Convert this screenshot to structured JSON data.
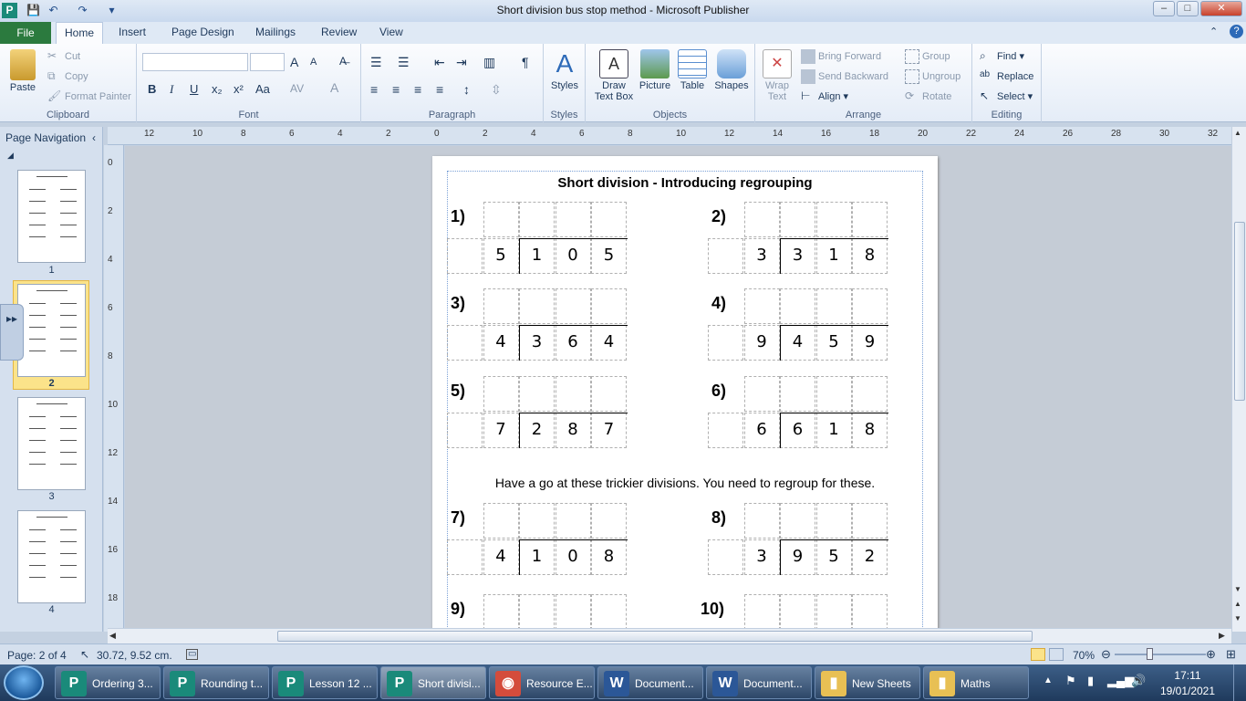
{
  "window": {
    "title": "Short division bus stop method  -  Microsoft Publisher",
    "app_icon": "publisher-icon",
    "quick_access": [
      "save-icon",
      "undo-icon",
      "redo-icon",
      "customize-icon"
    ],
    "controls": {
      "minimize": "–",
      "maximize": "□",
      "close": "✕"
    }
  },
  "tabs": {
    "file": "File",
    "items": [
      "Home",
      "Insert",
      "Page Design",
      "Mailings",
      "Review",
      "View"
    ],
    "selected": "Home"
  },
  "ribbon": {
    "clipboard": {
      "paste": "Paste",
      "cut": "Cut",
      "copy": "Copy",
      "format_painter": "Format Painter",
      "label": "Clipboard"
    },
    "font": {
      "label": "Font",
      "bold": "B",
      "italic": "I",
      "underline": "U",
      "subscript": "x₂",
      "superscript": "x²",
      "case": "Aa",
      "spacing": "AV",
      "color": "A",
      "grow": "A",
      "shrink": "A"
    },
    "paragraph": {
      "label": "Paragraph",
      "pilcrow": "¶"
    },
    "styles": {
      "styles": "Styles",
      "label": "Styles"
    },
    "objects": {
      "draw_text_box": "Draw\nText Box",
      "draw_line1": "Draw",
      "draw_line2": "Text Box",
      "picture": "Picture",
      "table": "Table",
      "shapes": "Shapes",
      "label": "Objects"
    },
    "arrange": {
      "wrap_text1": "Wrap",
      "wrap_text2": "Text",
      "bring_forward": "Bring Forward",
      "send_backward": "Send Backward",
      "align": "Align",
      "group": "Group",
      "ungroup": "Ungroup",
      "rotate": "Rotate",
      "label": "Arrange"
    },
    "editing": {
      "find": "Find",
      "replace": "Replace",
      "select": "Select",
      "label": "Editing"
    }
  },
  "nav": {
    "title": "Page Navigation",
    "pages": [
      "1",
      "2",
      "3",
      "4"
    ],
    "selected_page": "2"
  },
  "rulers": {
    "horizontal": [
      "12",
      "10",
      "8",
      "6",
      "4",
      "2",
      "0",
      "2",
      "4",
      "6",
      "8",
      "10",
      "12",
      "14",
      "16",
      "18",
      "20",
      "22",
      "24",
      "26",
      "28",
      "30",
      "32"
    ],
    "vertical": [
      "0",
      "2",
      "4",
      "6",
      "8",
      "10",
      "12",
      "14",
      "16",
      "18"
    ]
  },
  "document": {
    "title": "Short division - Introducing regrouping",
    "instruction": "Have a go at these trickier divisions. You need to regroup for these.",
    "problems": [
      {
        "label": "1)",
        "divisor": "5",
        "dividend": [
          "1",
          "0",
          "5"
        ]
      },
      {
        "label": "2)",
        "divisor": "3",
        "dividend": [
          "3",
          "1",
          "8"
        ]
      },
      {
        "label": "3)",
        "divisor": "4",
        "dividend": [
          "3",
          "6",
          "4"
        ]
      },
      {
        "label": "4)",
        "divisor": "9",
        "dividend": [
          "4",
          "5",
          "9"
        ]
      },
      {
        "label": "5)",
        "divisor": "7",
        "dividend": [
          "2",
          "8",
          "7"
        ]
      },
      {
        "label": "6)",
        "divisor": "6",
        "dividend": [
          "6",
          "1",
          "8"
        ]
      },
      {
        "label": "7)",
        "divisor": "4",
        "dividend": [
          "1",
          "0",
          "8"
        ]
      },
      {
        "label": "8)",
        "divisor": "3",
        "dividend": [
          "9",
          "5",
          "2"
        ]
      },
      {
        "label": "9)",
        "divisor": "",
        "dividend": [
          "",
          "",
          ""
        ]
      },
      {
        "label": "10)",
        "divisor": "",
        "dividend": [
          "",
          "",
          ""
        ]
      }
    ]
  },
  "status": {
    "page": "Page: 2 of 4",
    "position": "30.72, 9.52 cm.",
    "zoom": "70%",
    "zoom_level": 0.7
  },
  "taskbar": {
    "items": [
      {
        "label": "Ordering 3...",
        "icon": "P",
        "color": "#1a8a7a"
      },
      {
        "label": "Rounding t...",
        "icon": "P",
        "color": "#1a8a7a"
      },
      {
        "label": "Lesson 12 ...",
        "icon": "P",
        "color": "#1a8a7a"
      },
      {
        "label": "Short divisi...",
        "icon": "P",
        "color": "#1a8a7a",
        "active": true
      },
      {
        "label": "Resource E...",
        "icon": "◉",
        "color": "#d44c3c"
      },
      {
        "label": "Document...",
        "icon": "W",
        "color": "#2b5797"
      },
      {
        "label": "Document...",
        "icon": "W",
        "color": "#2b5797"
      },
      {
        "label": "New Sheets",
        "icon": "▮",
        "color": "#e8c054"
      },
      {
        "label": "Maths",
        "icon": "▮",
        "color": "#e8c054"
      }
    ],
    "time": "17:11",
    "date": "19/01/2021"
  },
  "colors": {
    "file_tab": "#2b7a3e",
    "accent": "#1e395b",
    "selected_thumb": "#fbe38a"
  }
}
